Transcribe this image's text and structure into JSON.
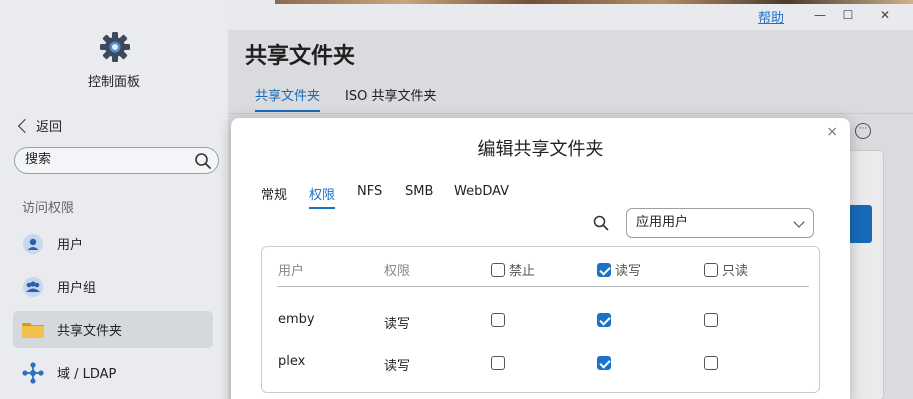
{
  "window": {
    "help_label": "帮助",
    "minimize_glyph": "—",
    "maximize_glyph": "☐",
    "close_glyph": "✕"
  },
  "sidebar": {
    "app_title": "控制面板",
    "back_label": "返回",
    "search_placeholder": "搜索",
    "section_label": "访问权限",
    "items": [
      {
        "label": "用户",
        "icon": "user-icon"
      },
      {
        "label": "用户组",
        "icon": "group-icon"
      },
      {
        "label": "共享文件夹",
        "icon": "folder-icon",
        "active": true
      },
      {
        "label": "域 / LDAP",
        "icon": "domain-icon"
      }
    ]
  },
  "main": {
    "title": "共享文件夹",
    "tabs": [
      {
        "label": "共享文件夹",
        "active": true
      },
      {
        "label": "ISO 共享文件夹",
        "active": false
      }
    ]
  },
  "dialog": {
    "title": "编辑共享文件夹",
    "close_glyph": "×",
    "tabs": [
      {
        "label": "常规",
        "active": false
      },
      {
        "label": "权限",
        "active": true
      },
      {
        "label": "NFS",
        "active": false
      },
      {
        "label": "SMB",
        "active": false
      },
      {
        "label": "WebDAV",
        "active": false
      }
    ],
    "user_type_select": "应用用户",
    "table": {
      "headers": {
        "user": "用户",
        "permission": "权限",
        "deny": "禁止",
        "readwrite": "读写",
        "readonly": "只读"
      },
      "header_checks": {
        "deny": false,
        "readwrite": true,
        "readonly": false
      },
      "rows": [
        {
          "user": "emby",
          "permission": "读写",
          "deny": false,
          "readwrite": true,
          "readonly": false
        },
        {
          "user": "plex",
          "permission": "读写",
          "deny": false,
          "readwrite": true,
          "readonly": false
        }
      ]
    }
  },
  "colors": {
    "accent": "#1a73c8",
    "folder": "#e8b526"
  }
}
